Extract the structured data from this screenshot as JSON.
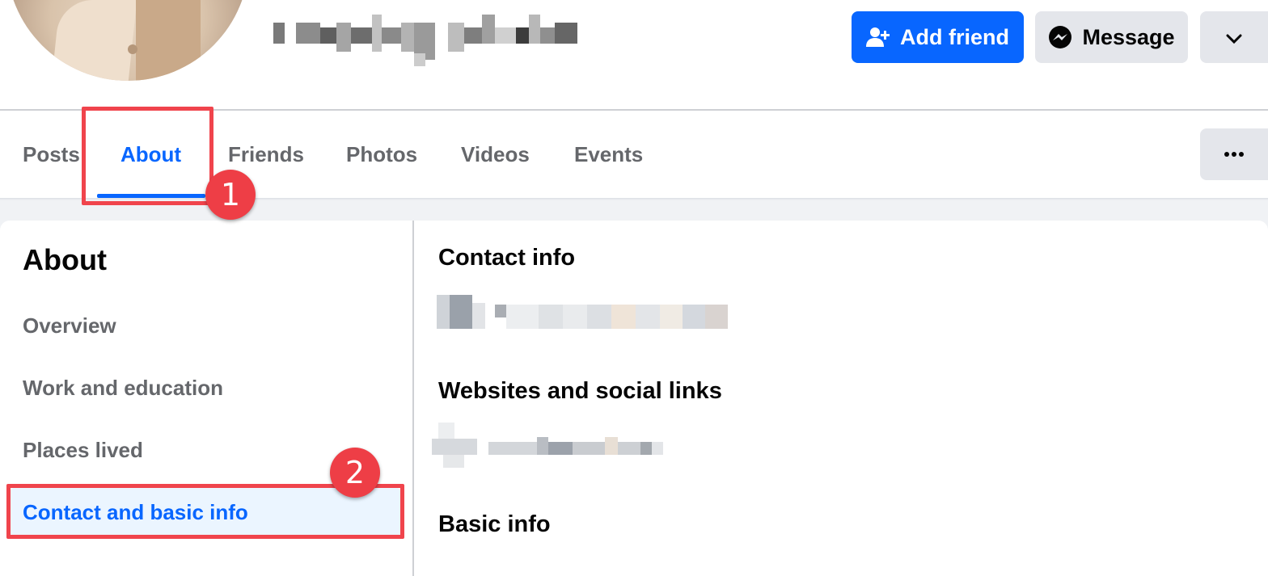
{
  "profile": {
    "name_redacted": true
  },
  "actions": {
    "add_friend_label": "Add friend",
    "message_label": "Message",
    "add_friend_icon": "person-plus-icon",
    "message_icon": "messenger-icon",
    "menu_icon": "chevron-down-icon"
  },
  "tabs": [
    {
      "label": "Posts",
      "active": false
    },
    {
      "label": "About",
      "active": true
    },
    {
      "label": "Friends",
      "active": false
    },
    {
      "label": "Photos",
      "active": false
    },
    {
      "label": "Videos",
      "active": false
    },
    {
      "label": "Events",
      "active": false
    }
  ],
  "about": {
    "title": "About",
    "items": [
      {
        "label": "Overview",
        "active": false
      },
      {
        "label": "Work and education",
        "active": false
      },
      {
        "label": "Places lived",
        "active": false
      },
      {
        "label": "Contact and basic info",
        "active": true
      }
    ]
  },
  "content": {
    "contact_info_title": "Contact info",
    "websites_title": "Websites and social links",
    "basic_info_title": "Basic info"
  },
  "annotations": {
    "step1": "1",
    "step2": "2"
  },
  "colors": {
    "accent": "#0866ff",
    "annotation": "#f0444c"
  }
}
